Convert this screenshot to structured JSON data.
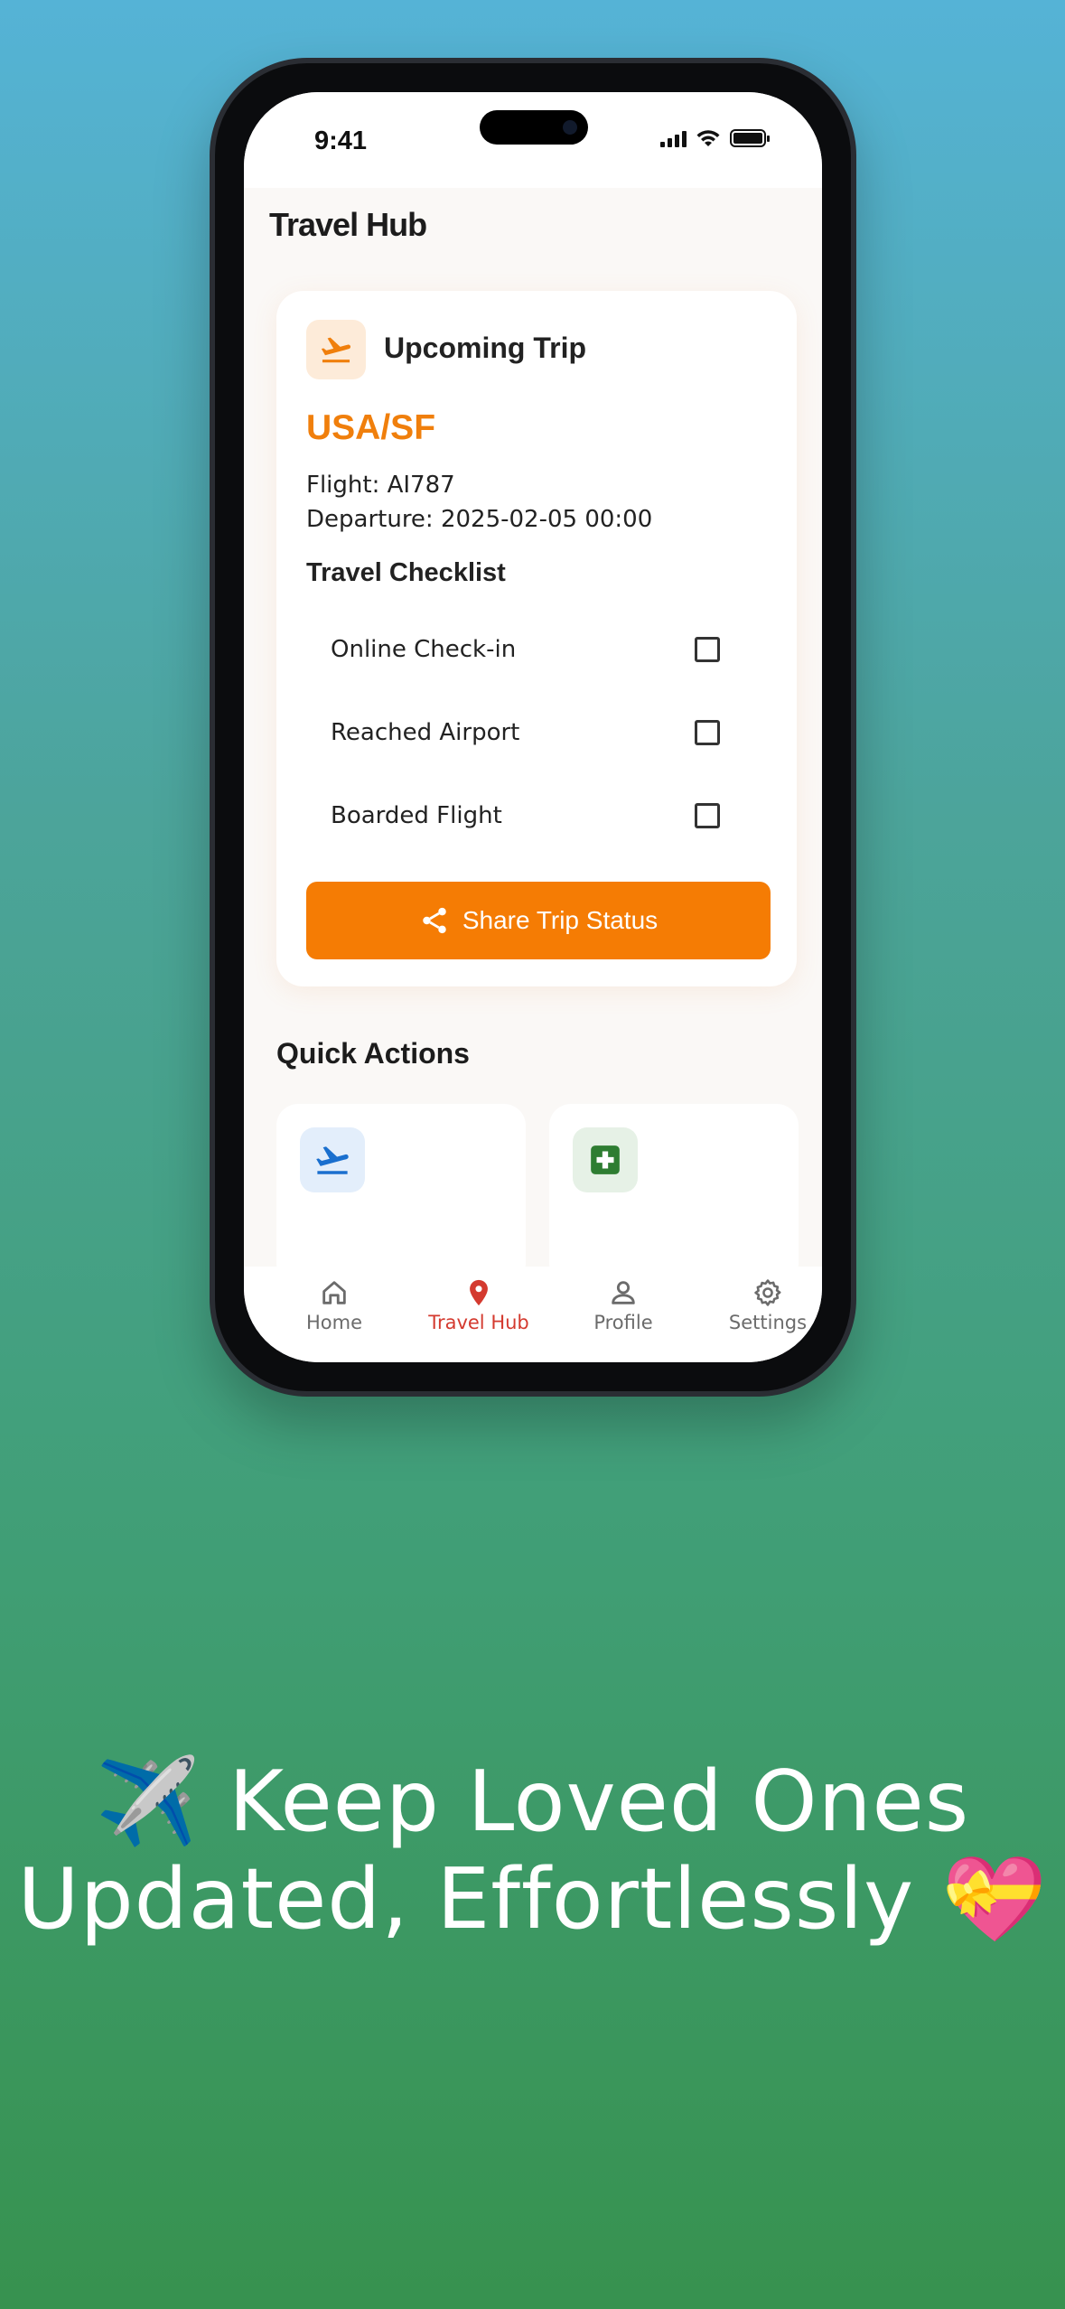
{
  "status_bar": {
    "time": "9:41"
  },
  "app": {
    "title": "Travel Hub"
  },
  "trip_card": {
    "heading": "Upcoming Trip",
    "destination": "USA/SF",
    "flight_line": "Flight: AI787",
    "departure_line": "Departure: 2025-02-05 00:00",
    "checklist_title": "Travel Checklist",
    "checklist": [
      {
        "label": "Online Check-in",
        "checked": false
      },
      {
        "label": "Reached Airport",
        "checked": false
      },
      {
        "label": "Boarded Flight",
        "checked": false
      }
    ],
    "share_button": "Share Trip Status"
  },
  "quick_actions": {
    "title": "Quick Actions"
  },
  "tab_bar": {
    "tabs": [
      {
        "label": "Home",
        "icon": "home-icon",
        "active": false
      },
      {
        "label": "Travel Hub",
        "icon": "map-pin-icon",
        "active": true
      },
      {
        "label": "Profile",
        "icon": "person-icon",
        "active": false
      },
      {
        "label": "Settings",
        "icon": "gear-icon",
        "active": false
      }
    ]
  },
  "caption": {
    "line1": "✈️ Keep Loved Ones",
    "line2": "Updated, Effortlessly 💝"
  },
  "colors": {
    "accent_orange": "#f57c04",
    "destination_orange": "#f07f0c",
    "active_tab_red": "#d43a2f",
    "quick_action_blue": "#1a6fce",
    "quick_action_green": "#2e7d32"
  }
}
